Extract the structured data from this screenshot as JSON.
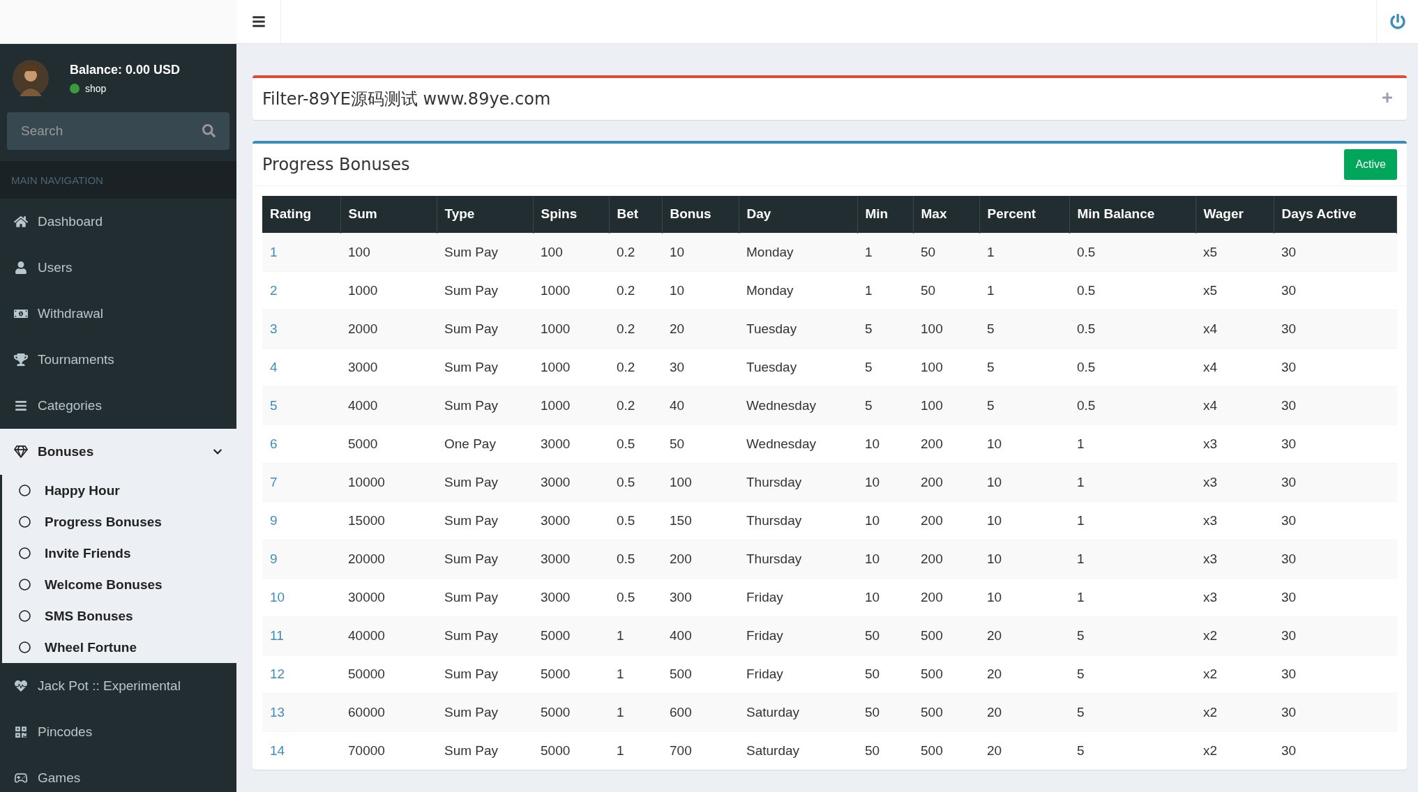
{
  "sidebar": {
    "user": {
      "balance": "Balance: 0.00 USD",
      "status": "shop",
      "online": true
    },
    "search": {
      "placeholder": "Search"
    },
    "header": "MAIN NAVIGATION",
    "items": [
      {
        "label": "Dashboard"
      },
      {
        "label": "Users"
      },
      {
        "label": "Withdrawal"
      },
      {
        "label": "Tournaments"
      },
      {
        "label": "Categories"
      },
      {
        "label": "Bonuses",
        "expanded": true,
        "children": [
          {
            "label": "Happy Hour"
          },
          {
            "label": "Progress Bonuses"
          },
          {
            "label": "Invite Friends"
          },
          {
            "label": "Welcome Bonuses"
          },
          {
            "label": "SMS Bonuses"
          },
          {
            "label": "Wheel Fortune"
          }
        ]
      },
      {
        "label": "Jack Pot :: Experimental"
      },
      {
        "label": "Pincodes"
      },
      {
        "label": "Games"
      }
    ]
  },
  "filter_card": {
    "title": "Filter-89YE源码测试 www.89ye.com"
  },
  "bonus_card": {
    "title": "Progress Bonuses",
    "status_button": "Active",
    "table": {
      "columns": [
        "Rating",
        "Sum",
        "Type",
        "Spins",
        "Bet",
        "Bonus",
        "Day",
        "Min",
        "Max",
        "Percent",
        "Min Balance",
        "Wager",
        "Days Active"
      ],
      "rows": [
        [
          "1",
          "100",
          "Sum Pay",
          "100",
          "0.2",
          "10",
          "Monday",
          "1",
          "50",
          "1",
          "0.5",
          "x5",
          "30"
        ],
        [
          "2",
          "1000",
          "Sum Pay",
          "1000",
          "0.2",
          "10",
          "Monday",
          "1",
          "50",
          "1",
          "0.5",
          "x5",
          "30"
        ],
        [
          "3",
          "2000",
          "Sum Pay",
          "1000",
          "0.2",
          "20",
          "Tuesday",
          "5",
          "100",
          "5",
          "0.5",
          "x4",
          "30"
        ],
        [
          "4",
          "3000",
          "Sum Pay",
          "1000",
          "0.2",
          "30",
          "Tuesday",
          "5",
          "100",
          "5",
          "0.5",
          "x4",
          "30"
        ],
        [
          "5",
          "4000",
          "Sum Pay",
          "1000",
          "0.2",
          "40",
          "Wednesday",
          "5",
          "100",
          "5",
          "0.5",
          "x4",
          "30"
        ],
        [
          "6",
          "5000",
          "One Pay",
          "3000",
          "0.5",
          "50",
          "Wednesday",
          "10",
          "200",
          "10",
          "1",
          "x3",
          "30"
        ],
        [
          "7",
          "10000",
          "Sum Pay",
          "3000",
          "0.5",
          "100",
          "Thursday",
          "10",
          "200",
          "10",
          "1",
          "x3",
          "30"
        ],
        [
          "9",
          "15000",
          "Sum Pay",
          "3000",
          "0.5",
          "150",
          "Thursday",
          "10",
          "200",
          "10",
          "1",
          "x3",
          "30"
        ],
        [
          "9",
          "20000",
          "Sum Pay",
          "3000",
          "0.5",
          "200",
          "Thursday",
          "10",
          "200",
          "10",
          "1",
          "x3",
          "30"
        ],
        [
          "10",
          "30000",
          "Sum Pay",
          "3000",
          "0.5",
          "300",
          "Friday",
          "10",
          "200",
          "10",
          "1",
          "x3",
          "30"
        ],
        [
          "11",
          "40000",
          "Sum Pay",
          "5000",
          "1",
          "400",
          "Friday",
          "50",
          "500",
          "20",
          "5",
          "x2",
          "30"
        ],
        [
          "12",
          "50000",
          "Sum Pay",
          "5000",
          "1",
          "500",
          "Friday",
          "50",
          "500",
          "20",
          "5",
          "x2",
          "30"
        ],
        [
          "13",
          "60000",
          "Sum Pay",
          "5000",
          "1",
          "600",
          "Saturday",
          "50",
          "500",
          "20",
          "5",
          "x2",
          "30"
        ],
        [
          "14",
          "70000",
          "Sum Pay",
          "5000",
          "1",
          "700",
          "Saturday",
          "50",
          "500",
          "20",
          "5",
          "x2",
          "30"
        ]
      ]
    }
  }
}
